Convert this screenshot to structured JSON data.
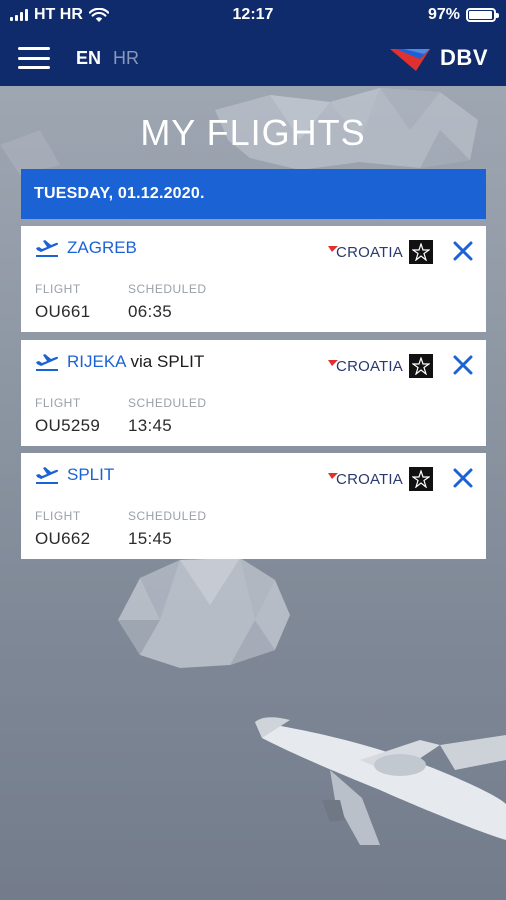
{
  "status_bar": {
    "carrier": "HT HR",
    "time": "12:17",
    "battery": "97%",
    "battery_level": 0.97
  },
  "header": {
    "languages": [
      {
        "code": "EN",
        "active": true
      },
      {
        "code": "HR",
        "active": false
      }
    ],
    "logo_text": "DBV"
  },
  "page_title": "MY FLIGHTS",
  "date_label": "TUESDAY, 01.12.2020.",
  "column_labels": {
    "flight": "FLIGHT",
    "scheduled": "SCHEDULED"
  },
  "flights": [
    {
      "destination": "ZAGREB",
      "via": "",
      "airline": "CROATIA",
      "flight": "OU661",
      "scheduled": "06:35"
    },
    {
      "destination": "RIJEKA",
      "via": "via SPLIT",
      "airline": "CROATIA",
      "flight": "OU5259",
      "scheduled": "13:45"
    },
    {
      "destination": "SPLIT",
      "via": "",
      "airline": "CROATIA",
      "flight": "OU662",
      "scheduled": "15:45"
    }
  ],
  "colors": {
    "navy": "#0f2b6b",
    "accent_blue": "#1b63d5",
    "brand_red": "#e0312f"
  },
  "icons": [
    "menu-icon",
    "wifi-icon",
    "battery-icon",
    "departure-plane-icon",
    "close-icon",
    "star-alliance-icon"
  ]
}
